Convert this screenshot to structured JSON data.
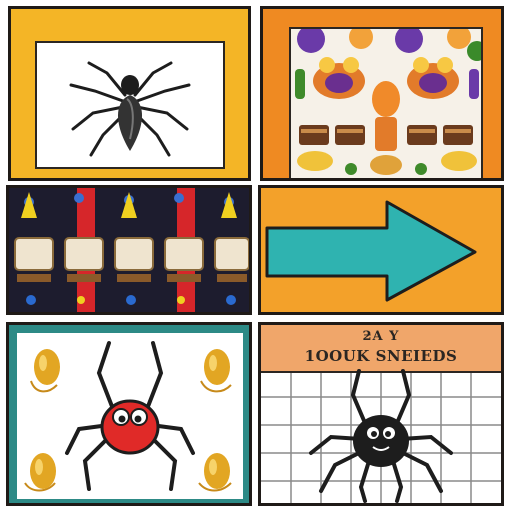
{
  "panels": [
    {
      "id": "spider-outline-card",
      "frame_color": "#f4b526"
    },
    {
      "id": "character-pattern-tile",
      "frame_color": "#ef8a22"
    },
    {
      "id": "boxes-pattern-tile",
      "frame_color": "#1d1c2e"
    },
    {
      "id": "arrow-card",
      "frame_color": "#f3a12a",
      "arrow_color": "#2fb3b0"
    },
    {
      "id": "cute-spider-card",
      "frame_color": "#2d8a86",
      "spider_color": "#e02a28"
    },
    {
      "id": "calendar-spider-card",
      "banner_color": "#f0a66a"
    }
  ],
  "banner": {
    "line1": "ƻA Y",
    "line2": "1OOUK SNEIEDS"
  },
  "icons": {
    "p1": "spider-icon",
    "p4": "arrow-right-icon",
    "p5": "red-spider-icon",
    "p6": "black-spider-icon"
  }
}
